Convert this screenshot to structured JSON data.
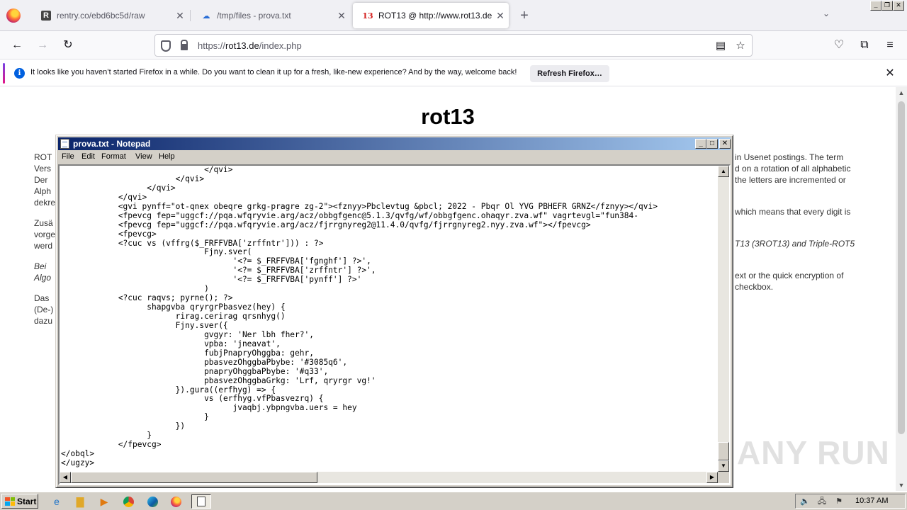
{
  "browser": {
    "tabs": [
      {
        "title": "rentry.co/ebd6bc5d/raw",
        "favicon": "R",
        "active": false
      },
      {
        "title": "/tmp/files - prova.txt",
        "favicon": "cloud-icon",
        "active": false
      },
      {
        "title": "ROT13 @ http://www.rot13.de/",
        "favicon": "13",
        "active": true
      }
    ],
    "newtab_symbol": "+",
    "address": {
      "scheme": "https://",
      "host": "rot13.de",
      "path": "/index.php"
    },
    "notification": {
      "message": "It looks like you haven’t started Firefox in a while. Do you want to clean it up for a fresh, like-new experience? And by the way, welcome back!",
      "button": "Refresh Firefox…"
    }
  },
  "page": {
    "title": "rot13",
    "left_fragments": [
      "ROT",
      "Vers",
      "Der",
      "Alph",
      "dekre",
      "Zusä",
      "vorge",
      "werd",
      "Bei",
      "Algo",
      "Das",
      "(De-)",
      "dazu"
    ],
    "right_fragments": [
      "in Usenet postings. The term",
      "d on a rotation of all alphabetic",
      "the letters are incremented or",
      "which means that every digit is",
      "T13 (3ROT13) and Triple-ROT5",
      "ext or the quick encryption of",
      "checkbox."
    ]
  },
  "notepad": {
    "title": "prova.txt - Notepad",
    "menu": [
      "File",
      "Edit",
      "Format",
      "View",
      "Help"
    ],
    "lines": [
      "                              </qvi>",
      "                        </qvi>",
      "                  </qvi>",
      "            </qvi>",
      "            <gvi pynff=\"ot-qnex obeqre grkg-pragre zg-2\"><fznyy>Pbclevtug &pbcl; 2022 - Pbqr Ol YVG PBHEFR GRNZ</fznyy></qvi>",
      "            <fpevcg fep=\"uggcf://pqa.wfqryvie.arg/acz/obbgfgenc@5.1.3/qvfg/wf/obbgfgenc.ohaqyr.zva.wf\" vagrtevgl=\"fun384-",
      "            <fpevcg fep=\"uggcf://pqa.wfqryvie.arg/acz/fjrrgnyreg2@11.4.0/qvfg/fjrrgnyreg2.nyy.zva.wf\"></fpevcg>",
      "            <fpevcg>",
      "            <?cuc vs (vffrg($_FRFFVBA['zrffntr'])) : ?>",
      "                              Fjny.sver(",
      "                                    '<?= $_FRFFVBA['fgnghf'] ?>',",
      "                                    '<?= $_FRFFVBA['zrffntr'] ?>',",
      "                                    '<?= $_FRFFVBA['pynff'] ?>'",
      "                              )",
      "            <?cuc raqvs; pyrne(); ?>",
      "                  shapgvba qryrgrPbasvez(hey) {",
      "                        rirag.cerirag qrsnhyg()",
      "                        Fjny.sver({",
      "                              gvgyr: 'Ner lbh fher?',",
      "                              vpba: 'jneavat',",
      "                              fubjPnapryOhggba: gehr,",
      "                              pbasvezOhggbaPbybe: '#3085q6',",
      "                              pnapryOhggbaPbybe: '#q33',",
      "                              pbasvezOhggbaGrkg: 'Lrf, qryrgr vg!'",
      "                        }).gura((erfhyg) => {",
      "                              vs (erfhyg.vfPbasvezrq) {",
      "                                    jvaqbj.ybpngvba.uers = hey",
      "                              }",
      "                        })",
      "                  }",
      "            </fpevcg>",
      "</obql>",
      "</ugzy>"
    ]
  },
  "watermark": "ANY RUN",
  "taskbar": {
    "start_label": "Start",
    "clock": "10:37 AM"
  }
}
